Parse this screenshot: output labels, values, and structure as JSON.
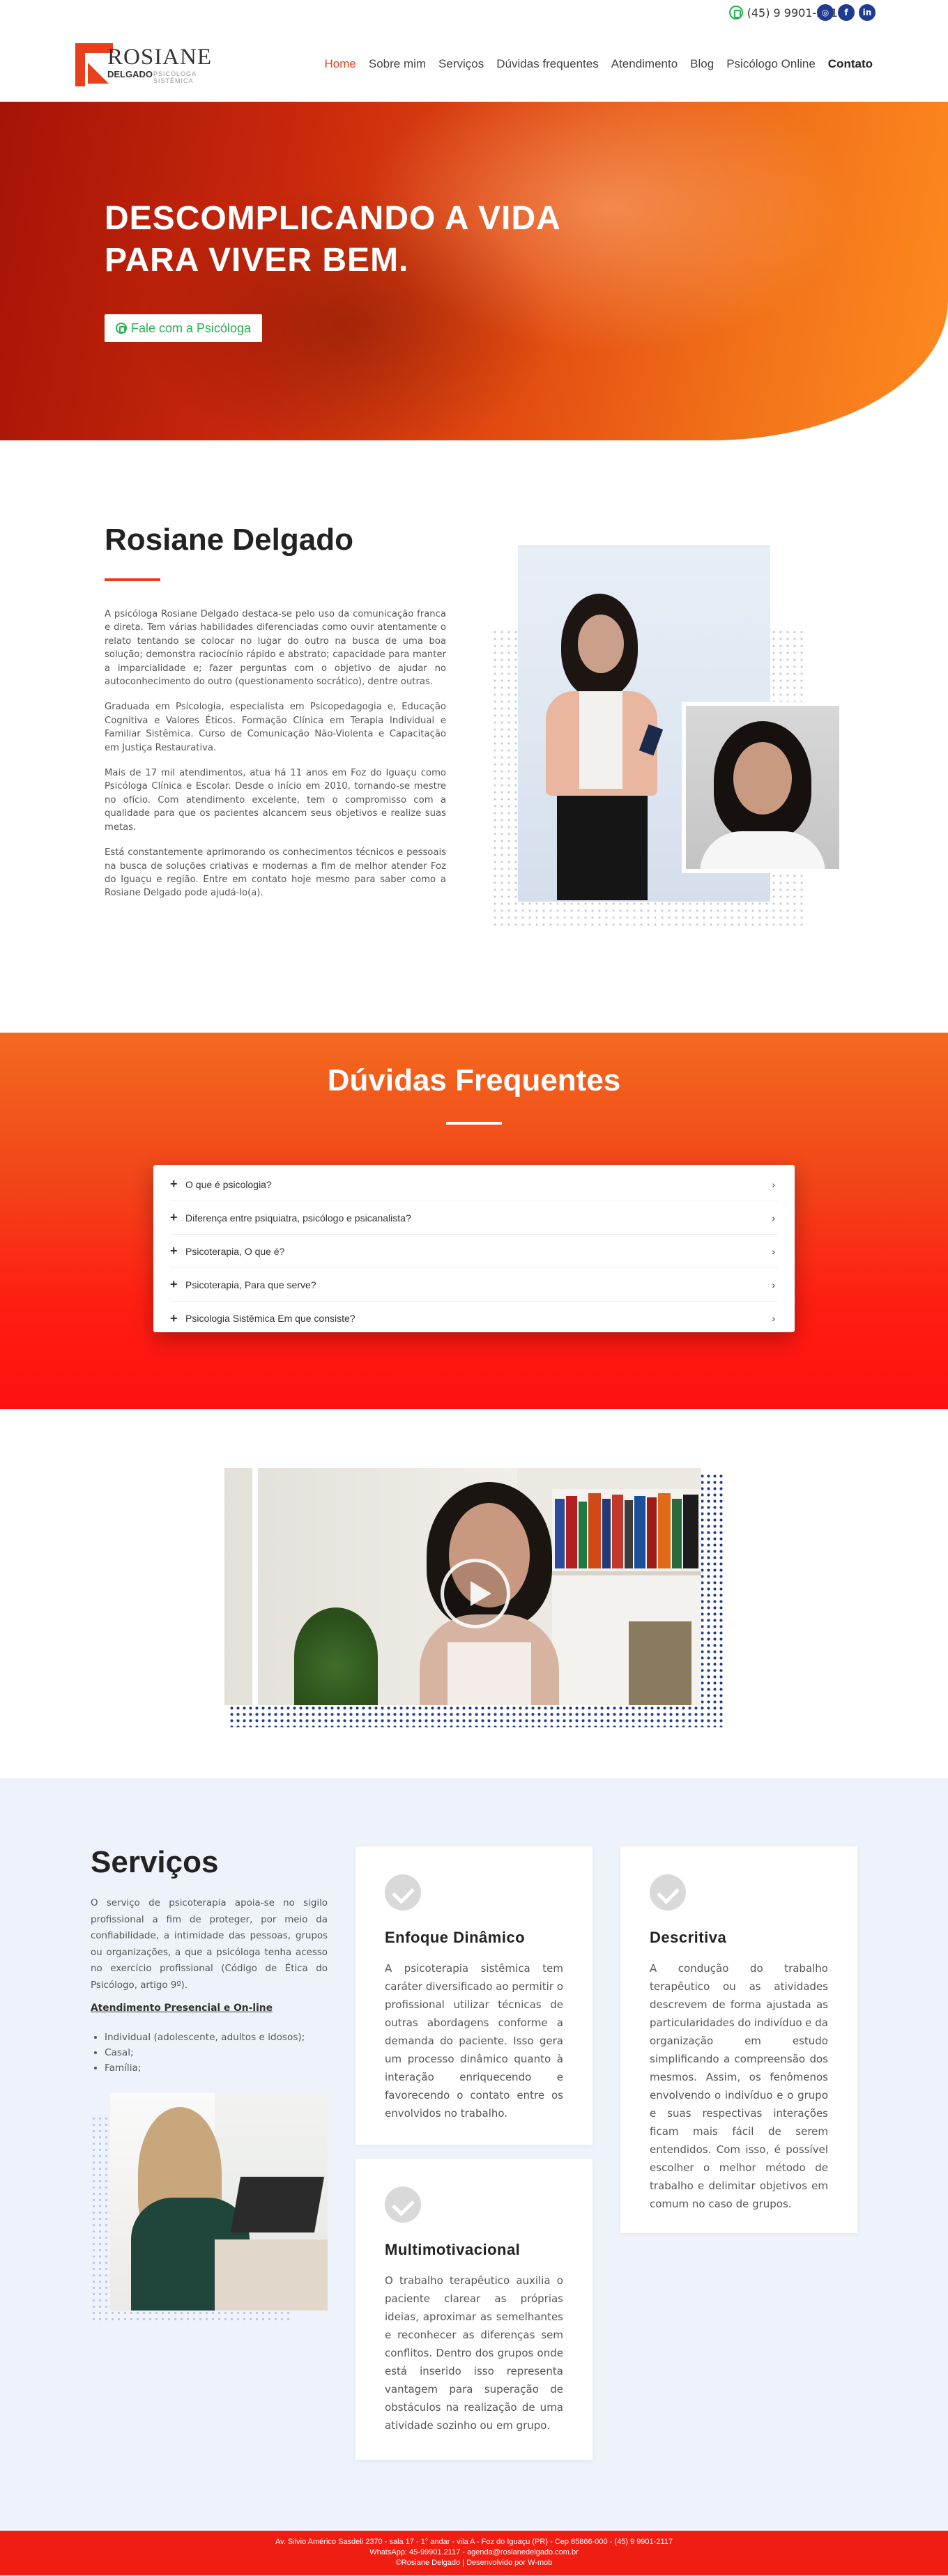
{
  "topbar": {
    "phone": "(45) 9 9901-2117",
    "social": [
      {
        "icon": "instagram-icon",
        "glyph": "◎"
      },
      {
        "icon": "facebook-icon",
        "glyph": "f"
      },
      {
        "icon": "linkedin-icon",
        "glyph": "in"
      }
    ]
  },
  "brand": {
    "name_top": "ROSIANE",
    "name_bottom": "DELGADO",
    "tagline": "PSICÓLOGA SISTÊMICA",
    "accent_color": "#e8401c"
  },
  "nav": {
    "items": [
      "Home",
      "Sobre mim",
      "Serviços",
      "Dúvidas frequentes",
      "Atendimento",
      "Blog",
      "Psicólogo Online",
      "Contato"
    ],
    "active": "Home"
  },
  "hero": {
    "title_line1": "DESCOMPLICANDO A VIDA",
    "title_line2": "PARA VIVER BEM.",
    "cta": "Fale com a Psicóloga"
  },
  "about": {
    "title": "Rosiane Delgado",
    "paragraphs": [
      "A psicóloga Rosiane Delgado destaca-se pelo uso da comunicação franca e direta. Tem várias habilidades diferenciadas como ouvir atentamente o relato tentando se colocar no lugar do outro na busca de uma boa solução; demonstra raciocínio rápido e abstrato; capacidade para manter a imparcialidade e; fazer perguntas com o objetivo de ajudar no autoconhecimento do outro (questionamento socrático), dentre outras.",
      "Graduada em Psicologia, especialista em Psicopedagogia e, Educação Cognitiva e Valores Éticos. Formação Clínica em Terapia Individual e Familiar Sistêmica. Curso de Comunicação Não-Violenta e Capacitação em Justiça Restaurativa.",
      "Mais de 17 mil atendimentos, atua há 11 anos em Foz do Iguaçu como Psicóloga Clínica e Escolar. Desde o início em 2010, tornando-se mestre no ofício. Com atendimento excelente, tem o compromisso com a qualidade para que os pacientes alcancem seus objetivos e realize suas metas.",
      "Está constantemente aprimorando os conhecimentos técnicos e pessoais na busca de soluções criativas e modernas a fim de melhor atender Foz do Iguaçu e região. Entre em contato hoje mesmo para saber como a Rosiane Delgado pode ajudá-lo(a)."
    ]
  },
  "faq": {
    "title": "Dúvidas Frequentes",
    "items": [
      "O que é psicologia?",
      "Diferença entre psiquiatra, psicólogo e psicanalista?",
      "Psicoterapia, O que é?",
      "Psicoterapia, Para que serve?",
      "Psicologia Sistêmica Em que consiste?"
    ]
  },
  "services": {
    "title": "Serviços",
    "intro": "O serviço de psicoterapia apoia-se no sigilo profissional a fim de proteger, por meio da confiabilidade, a intimidade das pessoas, grupos ou organizações, a que a psicóloga tenha acesso no exercício profissional (Código de Ética do Psicólogo, artigo 9º).",
    "subhead": "Atendimento Presencial e On-line",
    "list": [
      "Individual (adolescente, adultos e idosos);",
      "Casal;",
      "Família;"
    ],
    "cards": [
      {
        "title": "Enfoque Dinâmico",
        "text": "A psicoterapia sistêmica tem caráter diversificado ao permitir o profissional utilizar técnicas de outras abordagens conforme a demanda do paciente. Isso gera um processo dinâmico quanto à interação enriquecendo e favorecendo o contato entre os envolvidos no trabalho."
      },
      {
        "title": "Descritiva",
        "text": "A condução do trabalho terapêutico ou as atividades descrevem de forma ajustada as particularidades do indivíduo e da organização em estudo simplificando a compreensão dos mesmos. Assim, os fenômenos envolvendo o indivíduo e o grupo e suas respectivas interações ficam mais fácil de serem entendidos. Com isso, é possível escolher o melhor método de trabalho e delimitar objetivos em comum no caso de grupos."
      },
      {
        "title": "Multimotivacional",
        "text": "O trabalho terapêutico auxilia o paciente clarear as próprias ideias, aproximar as semelhantes e reconhecer as diferenças sem conflitos. Dentro dos grupos onde está inserido isso representa vantagem para superação de obstáculos na realização de uma atividade sozinho ou em grupo."
      }
    ]
  },
  "footer": {
    "line1": "Av. Silvio Américo Sasdeli 2370 - sala 17 - 1° andar - vila A - Foz do Iguaçu (PR) - Cep 85866-000 - (45) 9 9901-2117",
    "line2": "WhatsApp: 45-99901.2117 - agenda@rosianedelgado.com.br",
    "line3": "©Rosiane Delgado | Desenvolvido por W-mob"
  }
}
